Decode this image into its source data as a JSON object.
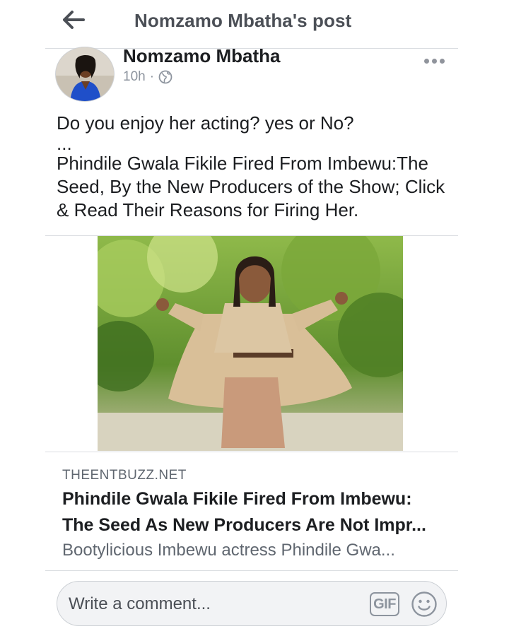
{
  "header": {
    "back_icon": "back-arrow-icon",
    "title": "Nomzamo Mbatha's post"
  },
  "post": {
    "author": "Nomzamo Mbatha",
    "time": "10h",
    "separator": "·",
    "privacy_icon": "globe-icon",
    "more_icon": "more-options-icon",
    "text_line1": "Do you enjoy her acting? yes or No?",
    "text_ellipsis": "...",
    "text_line2": "Phindile Gwala Fikile Fired From Imbewu:The Seed, By the New Producers of the Show; Click & Read Their Reasons for Firing Her."
  },
  "link": {
    "domain": "THEENTBUZZ.NET",
    "title_line1": "Phindile Gwala Fikile Fired From Imbewu:",
    "title_line2": "The Seed As New Producers Are Not Impr...",
    "description": "Bootylicious Imbewu actress Phindile Gwa..."
  },
  "comment": {
    "placeholder": "Write a comment...",
    "gif_label": "GIF",
    "emoji_icon": "smiley-icon"
  },
  "colors": {
    "text_primary": "#1c1e21",
    "text_secondary": "#606770",
    "divider": "#dadde1",
    "comment_bg": "#f2f3f5"
  }
}
